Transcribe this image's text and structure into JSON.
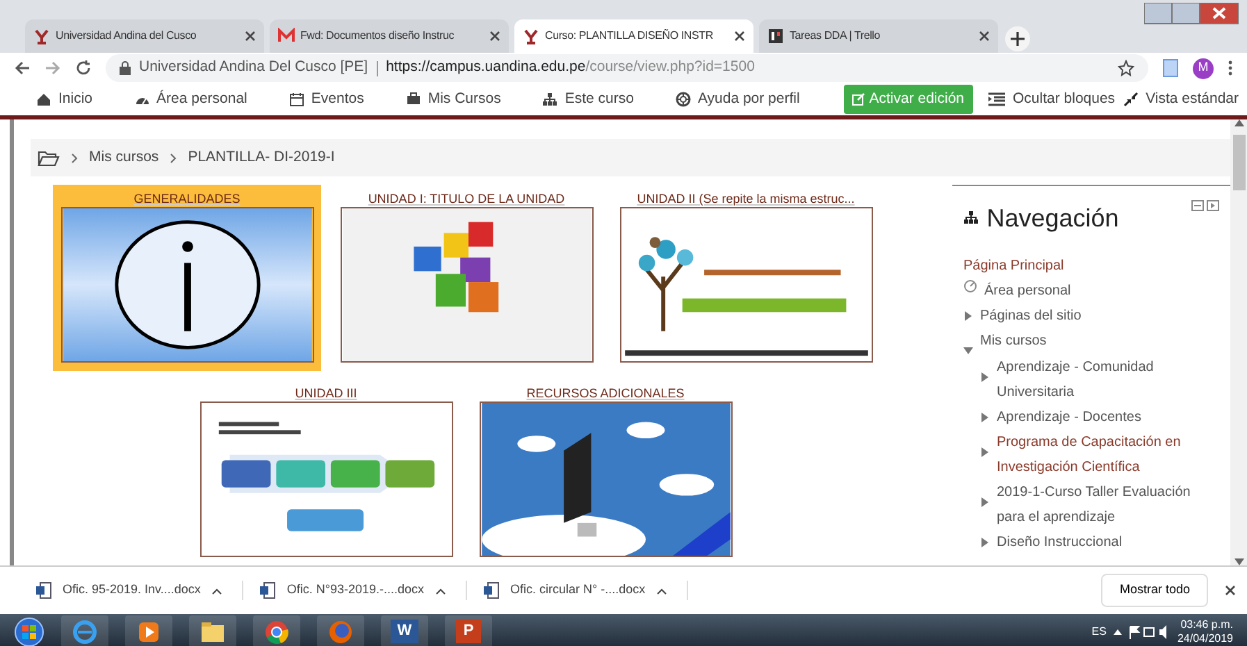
{
  "browser": {
    "tabs": [
      {
        "title": "Universidad Andina del Cusco",
        "kind": "site",
        "selected": false
      },
      {
        "title": "Fwd: Documentos diseño Instruc",
        "kind": "mail",
        "selected": false
      },
      {
        "title": "Curso: PLANTILLA DISEÑO INSTR",
        "kind": "site",
        "selected": true
      },
      {
        "title": "Tareas DDA | Trello",
        "kind": "board",
        "selected": false
      }
    ],
    "address": {
      "site": "Universidad Andina Del Cusco [PE]",
      "url_domain": "https://campus.uandina.edu.pe",
      "url_path": "/course/view.php?id=1500"
    },
    "profile_initial": "M"
  },
  "navbar": {
    "items": [
      {
        "label": "Inicio",
        "kind": "home"
      },
      {
        "label": "Área personal",
        "kind": "gauge"
      },
      {
        "label": "Eventos",
        "kind": "calendar"
      },
      {
        "label": "Mis Cursos",
        "kind": "briefcase"
      },
      {
        "label": "Este curso",
        "kind": "sitemap"
      },
      {
        "label": "Ayuda por perfil",
        "kind": "lifebuoy"
      }
    ],
    "edit_button": "Activar edición",
    "hide_blocks": "Ocultar bloques",
    "standard_view": "Vista estándar"
  },
  "breadcrumb": [
    "Mis cursos",
    "PLANTILLA- DI-2019-I"
  ],
  "tiles": [
    {
      "title": "GENERALIDADES",
      "kind": "info",
      "selected": true
    },
    {
      "title": "UNIDAD I: TITULO DE LA UNIDAD",
      "kind": "puzzle",
      "selected": false
    },
    {
      "title": "UNIDAD II (Se repite la misma estruc...",
      "kind": "tree",
      "selected": false
    },
    {
      "title": "UNIDAD III",
      "kind": "diagram",
      "selected": false
    },
    {
      "title": "RECURSOS ADICIONALES",
      "kind": "computer",
      "selected": false
    }
  ],
  "navigation": {
    "title": "Navegación",
    "items": [
      {
        "label": "Página Principal",
        "kind": "link",
        "is_link": true
      },
      {
        "label": "Área personal",
        "kind": "dashboard",
        "is_link": false
      },
      {
        "label": "Páginas del sitio",
        "kind": "branch",
        "expanded": false,
        "is_link": false
      },
      {
        "label": "Mis cursos",
        "kind": "branch",
        "expanded": true,
        "is_link": false,
        "children": [
          {
            "label": "Aprendizaje - Comunidad Universitaria",
            "kind": "branch",
            "expanded": false,
            "is_link": false
          },
          {
            "label": "Aprendizaje - Docentes",
            "kind": "branch",
            "expanded": false,
            "is_link": false
          },
          {
            "label": "Programa de Capacitación en Investigación Científica",
            "kind": "branch",
            "expanded": false,
            "is_link": true
          },
          {
            "label": "2019-1-Curso Taller Evaluación para el aprendizaje",
            "kind": "branch",
            "expanded": false,
            "is_link": false
          },
          {
            "label": "Diseño Instruccional",
            "kind": "branch",
            "expanded": false,
            "is_link": false
          }
        ]
      }
    ]
  },
  "downloads": {
    "files": [
      "Ofic. 95-2019. Inv....docx",
      "Ofic. N°93-2019.-....docx",
      "Ofic. circular N° -....docx"
    ],
    "show_all": "Mostrar todo"
  },
  "taskbar": {
    "apps": [
      {
        "kind": "ie"
      },
      {
        "kind": "media"
      },
      {
        "kind": "folder"
      },
      {
        "kind": "chrome"
      },
      {
        "kind": "firefox"
      },
      {
        "kind": "word",
        "glyph": "W"
      },
      {
        "kind": "slides",
        "glyph": "P"
      }
    ],
    "language": "ES",
    "time": "03:46 p.m.",
    "date": "24/04/2019"
  }
}
